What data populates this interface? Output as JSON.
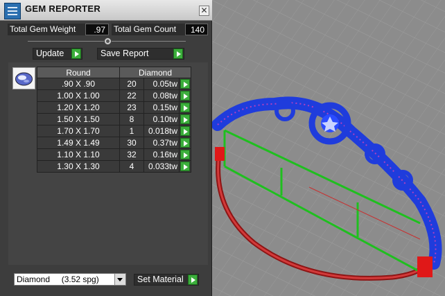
{
  "window": {
    "title": "GEM REPORTER",
    "close_glyph": "✕"
  },
  "summary": {
    "weight_label": "Total Gem Weight",
    "weight_value": ".97",
    "count_label": "Total Gem Count",
    "count_value": "140"
  },
  "buttons": {
    "update": "Update",
    "save_report": "Save Report",
    "set_material": "Set Material"
  },
  "table": {
    "shape_header": "Round",
    "material_header": "Diamond",
    "rows": [
      {
        "size": ".90 X .90",
        "count": "20",
        "weight": "0.05tw"
      },
      {
        "size": "1.00 X 1.00",
        "count": "22",
        "weight": "0.08tw"
      },
      {
        "size": "1.20 X 1.20",
        "count": "23",
        "weight": "0.15tw"
      },
      {
        "size": "1.50 X 1.50",
        "count": "8",
        "weight": "0.10tw"
      },
      {
        "size": "1.70 X 1.70",
        "count": "1",
        "weight": "0.018tw"
      },
      {
        "size": "1.49 X 1.49",
        "count": "30",
        "weight": "0.37tw"
      },
      {
        "size": "1.10 X 1.10",
        "count": "32",
        "weight": "0.16tw"
      },
      {
        "size": "1.30 X 1.30",
        "count": "4",
        "weight": "0.033tw"
      }
    ]
  },
  "material": {
    "selected": "Diamond     (3.52 spg)"
  },
  "icons": {
    "app": "gem-reporter-icon",
    "gem": "round-gem-icon",
    "row_action": "play-arrow-icon"
  },
  "colors": {
    "accent_green": "#3cae3c",
    "panel_bg": "#3d3d3d",
    "model_blue": "#1f3cdc",
    "model_red": "#c81e1e"
  }
}
